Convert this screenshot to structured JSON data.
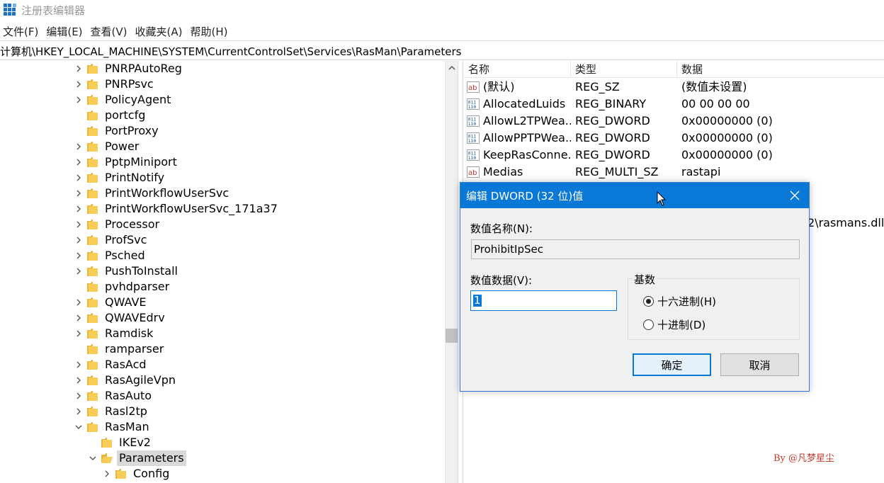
{
  "window": {
    "title": "注册表编辑器",
    "icon": "registry-editor-icon"
  },
  "menu": [
    "文件(F)",
    "编辑(E)",
    "查看(V)",
    "收藏夹(A)",
    "帮助(H)"
  ],
  "address": "计算机\\HKEY_LOCAL_MACHINE\\SYSTEM\\CurrentControlSet\\Services\\RasMan\\Parameters",
  "tree": {
    "items": [
      {
        "label": "PNRPAutoReg",
        "expandable": true
      },
      {
        "label": "PNRPsvc",
        "expandable": true
      },
      {
        "label": "PolicyAgent",
        "expandable": true
      },
      {
        "label": "portcfg",
        "expandable": false
      },
      {
        "label": "PortProxy",
        "expandable": false
      },
      {
        "label": "Power",
        "expandable": true
      },
      {
        "label": "PptpMiniport",
        "expandable": true
      },
      {
        "label": "PrintNotify",
        "expandable": true
      },
      {
        "label": "PrintWorkflowUserSvc",
        "expandable": true
      },
      {
        "label": "PrintWorkflowUserSvc_171a37",
        "expandable": true
      },
      {
        "label": "Processor",
        "expandable": true
      },
      {
        "label": "ProfSvc",
        "expandable": true
      },
      {
        "label": "Psched",
        "expandable": true
      },
      {
        "label": "PushToInstall",
        "expandable": true
      },
      {
        "label": "pvhdparser",
        "expandable": false
      },
      {
        "label": "QWAVE",
        "expandable": true
      },
      {
        "label": "QWAVEdrv",
        "expandable": true
      },
      {
        "label": "Ramdisk",
        "expandable": true
      },
      {
        "label": "ramparser",
        "expandable": false
      },
      {
        "label": "RasAcd",
        "expandable": true
      },
      {
        "label": "RasAgileVpn",
        "expandable": true
      },
      {
        "label": "RasAuto",
        "expandable": true
      },
      {
        "label": "Rasl2tp",
        "expandable": true
      },
      {
        "label": "RasMan",
        "expandable": true,
        "expanded": true
      },
      {
        "label": "IKEv2",
        "expandable": false,
        "level": 1
      },
      {
        "label": "Parameters",
        "expandable": true,
        "expanded": true,
        "level": 1,
        "selected": true
      },
      {
        "label": "Config",
        "expandable": true,
        "level": 2
      }
    ]
  },
  "list": {
    "headers": [
      "名称",
      "类型",
      "数据"
    ],
    "rows": [
      {
        "icon": "string-value-icon",
        "name": "(默认)",
        "type": "REG_SZ",
        "data": "(数值未设置)"
      },
      {
        "icon": "binary-value-icon",
        "name": "AllocatedLuids",
        "type": "REG_BINARY",
        "data": "00 00 00 00"
      },
      {
        "icon": "binary-value-icon",
        "name": "AllowL2TPWea...",
        "type": "REG_DWORD",
        "data": "0x00000000 (0)"
      },
      {
        "icon": "binary-value-icon",
        "name": "AllowPPTPWea...",
        "type": "REG_DWORD",
        "data": "0x00000000 (0)"
      },
      {
        "icon": "binary-value-icon",
        "name": "KeepRasConne...",
        "type": "REG_DWORD",
        "data": "0x00000000 (0)"
      },
      {
        "icon": "string-value-icon",
        "name": "Medias",
        "type": "REG_MULTI_SZ",
        "data": "rastapi"
      }
    ],
    "partial_visible_text": "2\\rasmans.dll"
  },
  "dialog": {
    "title": "编辑 DWORD (32 位)值",
    "name_label": "数值名称(N):",
    "name_value": "ProhibitIpSec",
    "data_label": "数值数据(V):",
    "data_value": "1",
    "base_label": "基数",
    "radio_hex": "十六进制(H)",
    "radio_dec": "十进制(D)",
    "selected_base": "hex",
    "ok": "确定",
    "cancel": "取消"
  },
  "watermark": "By @凡梦星尘",
  "colors": {
    "accent": "#0a78d7",
    "folder": "#f5c242",
    "watermark": "#c0392b"
  }
}
